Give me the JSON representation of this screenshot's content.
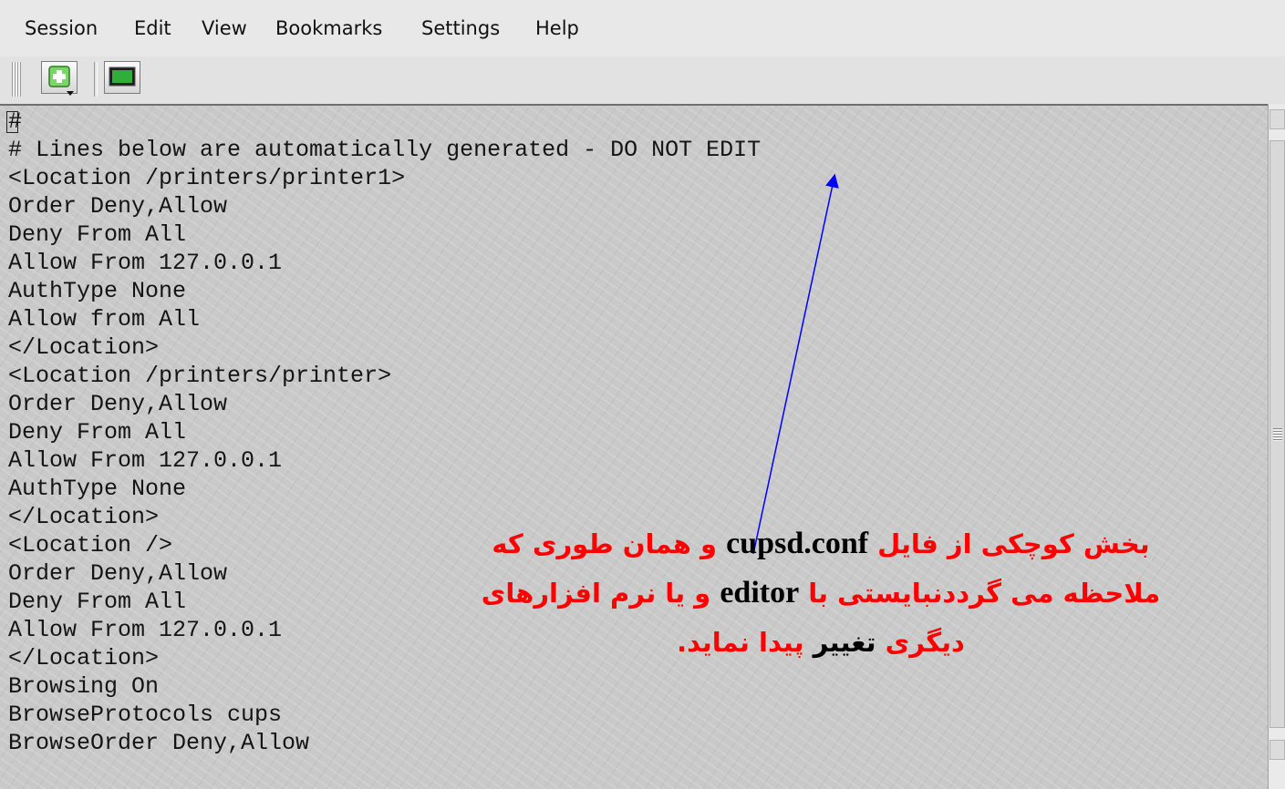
{
  "menubar": {
    "items": [
      "Session",
      "Edit",
      "View",
      "Bookmarks",
      "Settings",
      "Help"
    ]
  },
  "toolbar": {
    "icons": [
      "new-session-icon",
      "terminal-icon"
    ]
  },
  "terminal": {
    "lines": [
      "#",
      "# Lines below are automatically generated - DO NOT EDIT",
      "<Location /printers/printer1>",
      "Order Deny,Allow",
      "Deny From All",
      "Allow From 127.0.0.1",
      "AuthType None",
      "Allow from All",
      "</Location>",
      "<Location /printers/printer>",
      "Order Deny,Allow",
      "Deny From All",
      "Allow From 127.0.0.1",
      "AuthType None",
      "</Location>",
      "<Location />",
      "Order Deny,Allow",
      "Deny From All",
      "Allow From 127.0.0.1",
      "</Location>",
      "Browsing On",
      "BrowseProtocols cups",
      "BrowseOrder Deny,Allow"
    ]
  },
  "annotation": {
    "line1_part1": "بخش کوچکی از فایل",
    "line1_en": "cupsd.conf",
    "line1_part2": "و همان طوری که",
    "line2_part1": "ملاحظه می گرددنبایستی با",
    "line2_en": "editor",
    "line2_part2": "و یا نرم افزارهای",
    "line3_part1": "دیگری",
    "line3_black": "تغییر",
    "line3_part2": "پیدا نماید.",
    "text_color": "#ff0000",
    "arrow_color": "#0000ff"
  }
}
